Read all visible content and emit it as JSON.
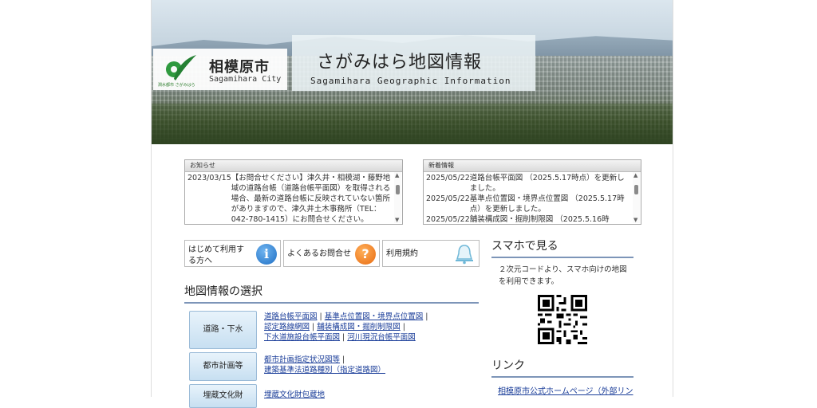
{
  "header": {
    "city_name": "相模原市",
    "city_name_en": "Sagamihara City",
    "logo_tagline": "潤水都市 さがみはら",
    "title": "さがみはら地図情報",
    "subtitle": "Sagamihara Geographic Information"
  },
  "notices": {
    "heading": "お知らせ",
    "items": [
      {
        "date": "2023/03/15",
        "text": "【お問合せください】津久井・相模湖・藤野地域の道路台帳（道路台帳平面図）を取得される場合、最新の道路台帳に反映されていない箇所がありますので、津久井土木事務所（TEL：042-780-1415）にお問合せください。"
      }
    ]
  },
  "updates": {
    "heading": "新着情報",
    "items": [
      {
        "date": "2025/05/22",
        "text": "道路台帳平面図 （2025.5.17時点）を更新しました。"
      },
      {
        "date": "2025/05/22",
        "text": "基準点位置図・境界点位置図 （2025.5.17時点）を更新しました。"
      },
      {
        "date": "2025/05/22",
        "text": "舗装構成図・掘削制限図 （2025.5.16時"
      }
    ]
  },
  "quick_buttons": {
    "beginner": "はじめて利用する方へ",
    "faq": "よくあるお問合せ",
    "terms": "利用規約"
  },
  "map_section": {
    "title": "地図情報の選択",
    "categories": [
      {
        "label": "道路・下水",
        "links": [
          "道路台帳平面図",
          "基準点位置図・境界点位置図",
          "認定路線網図",
          "舗装構成図・掘削制限図",
          "下水道施設台帳平面図",
          "河川現況台帳平面図"
        ]
      },
      {
        "label": "都市計画等",
        "links": [
          "都市計画指定状況図等",
          "建築基準法道路種別（指定道路図）"
        ]
      },
      {
        "label": "埋蔵文化財",
        "links": [
          "埋蔵文化財包蔵地"
        ]
      }
    ]
  },
  "smartphone": {
    "title": "スマホで見る",
    "text": "２次元コードより、スマホ向けの地図を利用できます。"
  },
  "links_section": {
    "title": "リンク",
    "items": [
      "相模原市公式ホームページ（外部リン"
    ]
  },
  "colors": {
    "link": "#1a3d99",
    "section_underline": "#7d95b8",
    "info_icon": "#2f7fd1",
    "faq_icon": "#f07d1a",
    "bell_icon": "#6fb8d8"
  }
}
